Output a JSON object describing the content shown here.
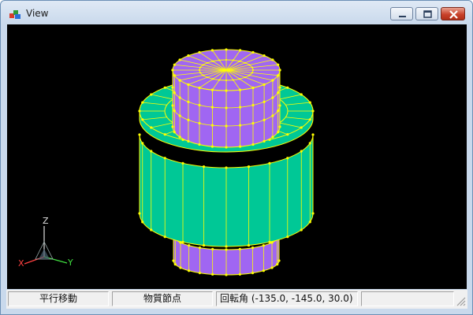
{
  "window": {
    "title": "View",
    "colors": {
      "frame": "#c9d9ec",
      "close": "#c9422b",
      "viewport_bg": "#000000"
    }
  },
  "title_controls": {
    "minimize_icon": "minimize-icon",
    "maximize_icon": "maximize-icon",
    "close_icon": "close-icon"
  },
  "viewport": {
    "model_colors": {
      "mesh_line": "#ffff00",
      "mesh_node": "#ffff00",
      "top_face": "#a066f2",
      "side_face": "#00c896"
    },
    "axis": {
      "z": "Z",
      "x": "X",
      "y": "Y",
      "z_color": "#e0e0e0",
      "x_color": "#ff4040",
      "y_color": "#40e040"
    }
  },
  "statusbar": {
    "pane1": "平行移動",
    "pane2": "物質節点",
    "pane3": "回転角 (-135.0, -145.0, 30.0)",
    "pane4": ""
  }
}
